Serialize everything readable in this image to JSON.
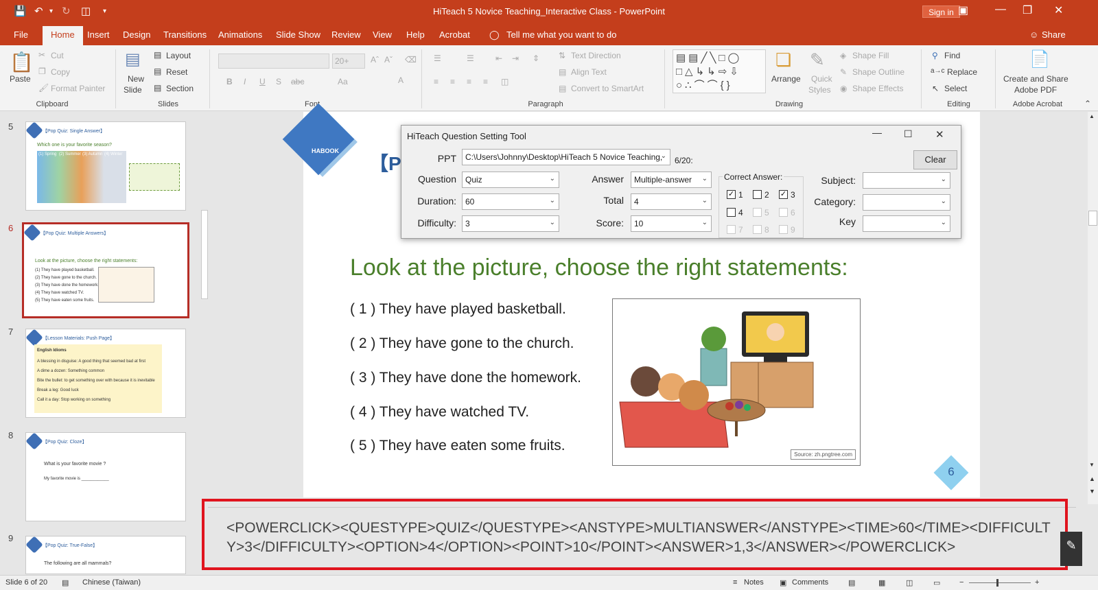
{
  "titlebar": {
    "title": "HiTeach 5 Novice Teaching_Interactive Class  -  PowerPoint",
    "sign_in": "Sign in",
    "icons": [
      "save-icon",
      "undo-icon",
      "redo-icon",
      "present-icon",
      "customize-icon"
    ]
  },
  "menu": {
    "tabs": [
      "File",
      "Home",
      "Insert",
      "Design",
      "Transitions",
      "Animations",
      "Slide Show",
      "Review",
      "View",
      "Help",
      "Acrobat"
    ],
    "tell_me": "Tell me what you want to do",
    "share": "Share"
  },
  "ribbon": {
    "clipboard": {
      "paste": "Paste",
      "cut": "Cut",
      "copy": "Copy",
      "format_painter": "Format Painter",
      "label": "Clipboard"
    },
    "slides": {
      "new_slide_1": "New",
      "new_slide_2": "Slide",
      "layout": "Layout",
      "reset": "Reset",
      "section": "Section",
      "label": "Slides"
    },
    "font": {
      "size": "20+",
      "label": "Font",
      "bold": "B",
      "italic": "I",
      "underline": "U",
      "shadow": "S",
      "strike": "abc",
      "aa": "Aa"
    },
    "paragraph": {
      "text_direction": "Text Direction",
      "align_text": "Align Text",
      "smartart": "Convert to SmartArt",
      "label": "Paragraph"
    },
    "drawing": {
      "arrange": "Arrange",
      "quick_styles_1": "Quick",
      "quick_styles_2": "Styles",
      "shape_fill": "Shape Fill",
      "shape_outline": "Shape Outline",
      "shape_effects": "Shape Effects",
      "label": "Drawing"
    },
    "editing": {
      "find": "Find",
      "replace": "Replace",
      "select": "Select",
      "label": "Editing"
    },
    "acrobat": {
      "create_1": "Create and Share",
      "create_2": "Adobe PDF",
      "label": "Adobe Acrobat"
    }
  },
  "thumbnails": [
    {
      "num": "5",
      "title": "【Pop Quiz: Single Answer】",
      "line1": "Which one is your favorite season?",
      "labels": [
        "(1) Spring",
        "(2) Summer",
        "(3) Autumn",
        "(4) Winter"
      ]
    },
    {
      "num": "6",
      "title": "【Pop Quiz: Multiple Answers】",
      "line1": "Look at the picture,  choose the right statements:",
      "items": [
        "(1) They have played basketball.",
        "(2) They have gone to the church.",
        "(3) They have done the homework.",
        "(4) They have watched TV.",
        "(5) They have eaten some fruits."
      ]
    },
    {
      "num": "7",
      "title": "【Lesson Materials: Push Page】",
      "line1": "English Idioms",
      "items": [
        "A blessing in disguise: A good thing that seemed bad at first",
        "A dime a dozen: Something common",
        "Bite the bullet: to get something over with because it is inevitable",
        "Break a leg: Good luck",
        "Call it a day: Stop working on something"
      ]
    },
    {
      "num": "8",
      "title": "【Pop Quiz: Cloze】",
      "line1": "What is your favorite movie ?",
      "items": [
        "My favorite movie is ____________"
      ]
    },
    {
      "num": "9",
      "title": "【Pop Quiz: True-False】",
      "line1": "The following are all mammals?"
    }
  ],
  "slide": {
    "logo": "HABOOK",
    "title_fragment": "【P",
    "heading": "Look at the picture,  choose the right statements:",
    "statements": [
      "( 1 ) They have played basketball.",
      "( 2 ) They have gone to the church.",
      "( 3 ) They have done the homework.",
      "( 4 ) They have watched TV.",
      "( 5 ) They have eaten some fruits."
    ],
    "image_source": "Source: zh.pngtree.com",
    "page_number": "6"
  },
  "dialog": {
    "title": "HiTeach Question Setting Tool",
    "ppt_label": "PPT",
    "ppt_value": "C:\\Users\\Johnny\\Desktop\\HiTeach 5 Novice Teaching,",
    "ppt_count": "6/20:",
    "clear": "Clear",
    "question_label": "Question",
    "question_value": "Quiz",
    "duration_label": "Duration:",
    "duration_value": "60",
    "difficulty_label": "Difficulty:",
    "difficulty_value": "3",
    "answer_label": "Answer",
    "answer_value": "Multiple-answer",
    "total_label": "Total",
    "total_value": "4",
    "score_label": "Score:",
    "score_value": "10",
    "correct_answer_label": "Correct Answer:",
    "options": [
      {
        "label": "1",
        "checked": true,
        "enabled": true
      },
      {
        "label": "2",
        "checked": false,
        "enabled": true
      },
      {
        "label": "3",
        "checked": true,
        "enabled": true
      },
      {
        "label": "4",
        "checked": false,
        "enabled": true
      },
      {
        "label": "5",
        "checked": false,
        "enabled": false
      },
      {
        "label": "6",
        "checked": false,
        "enabled": false
      },
      {
        "label": "7",
        "checked": false,
        "enabled": false
      },
      {
        "label": "8",
        "checked": false,
        "enabled": false
      },
      {
        "label": "9",
        "checked": false,
        "enabled": false
      }
    ],
    "subject_label": "Subject:",
    "category_label": "Category:",
    "key_label": "Key"
  },
  "notes": {
    "text": "<POWERCLICK><QUESTYPE>QUIZ</QUESTYPE><ANSTYPE>MULTIANSWER</ANSTYPE><TIME>60</TIME><DIFFICULTY>3</DIFFICULTY><OPTION>4</OPTION><POINT>10</POINT><ANSWER>1,3</ANSWER></POWERCLICK>"
  },
  "status": {
    "slide_info": "Slide 6 of 20",
    "language": "Chinese (Taiwan)",
    "notes": "Notes",
    "comments": "Comments"
  },
  "colors": {
    "accent": "#c43e1c",
    "heading_green": "#4a7f2b",
    "highlight_red": "#e0141e",
    "selected_thumb": "#b62d26"
  }
}
